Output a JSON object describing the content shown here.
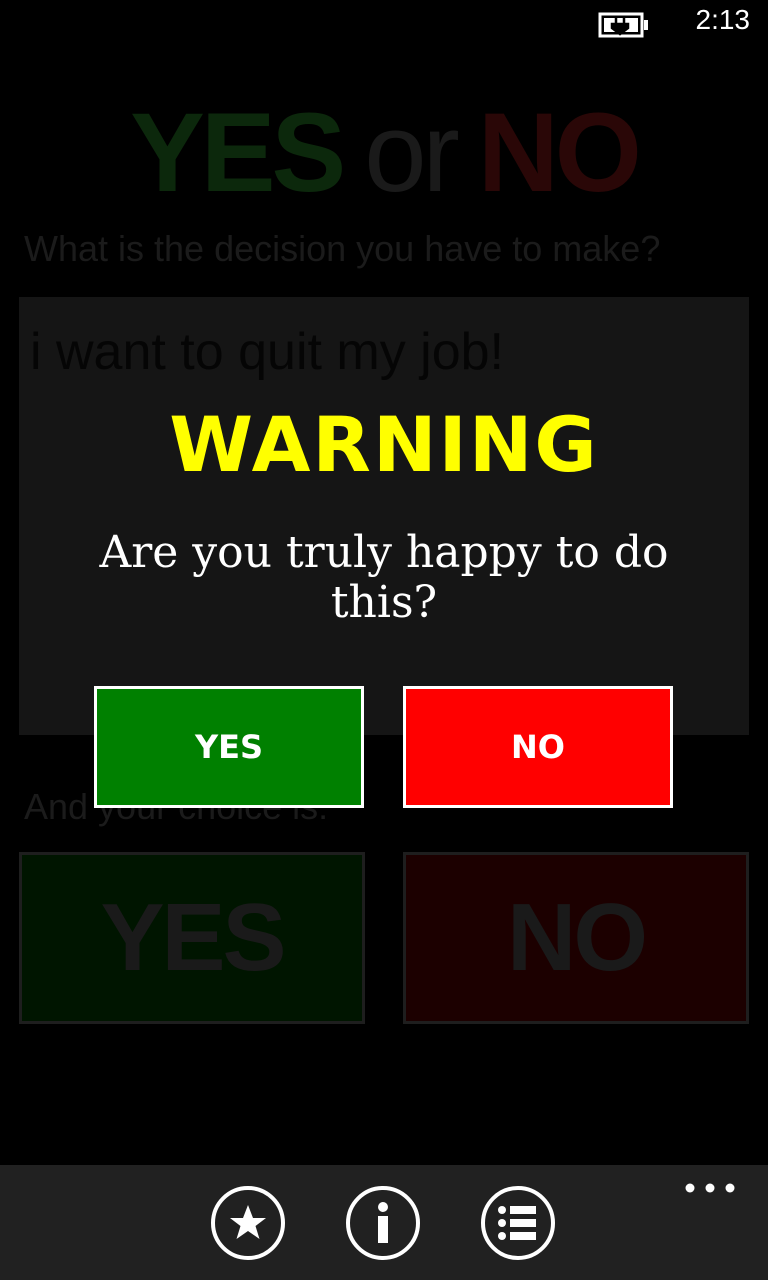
{
  "status_bar": {
    "time": "2:13",
    "battery_icon": "battery-charging-icon"
  },
  "app": {
    "title": {
      "yes": "YES",
      "or": "or",
      "no": "NO"
    },
    "question_label": "What is the decision you have to make?",
    "decision_text": "i want to quit my job!",
    "choice_label": "And your choice is:",
    "choice_yes": "YES",
    "choice_no": "NO"
  },
  "dialog": {
    "title": "WARNING",
    "message": "Are you truly happy to do this?",
    "yes_label": "YES",
    "no_label": "NO"
  },
  "app_bar": {
    "buttons": [
      "star-icon",
      "info-icon",
      "list-icon"
    ],
    "more_icon": "more-icon"
  },
  "colors": {
    "warning_title": "#ffff00",
    "yes_button": "#008000",
    "no_button": "#ff0000",
    "app_bar": "#212121"
  }
}
